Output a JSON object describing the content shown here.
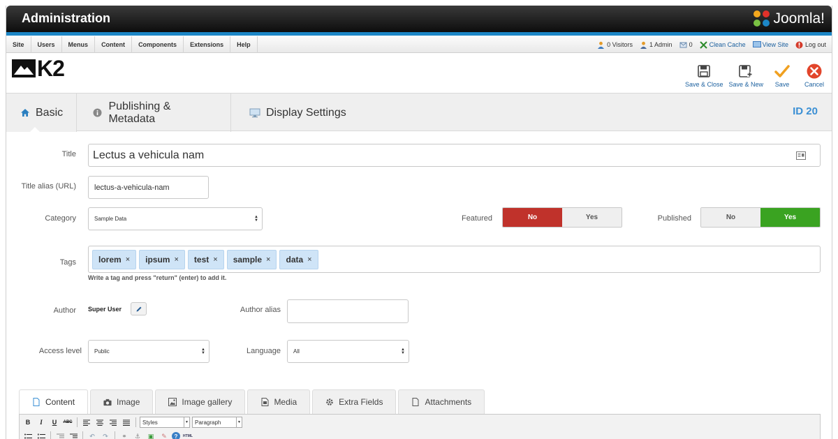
{
  "header": {
    "title": "Administration",
    "brand": "Joomla!"
  },
  "menu": {
    "items": [
      "Site",
      "Users",
      "Menus",
      "Content",
      "Components",
      "Extensions",
      "Help"
    ]
  },
  "status": {
    "visitors": "0 Visitors",
    "admins": "1 Admin",
    "messages": "0",
    "clean_cache": "Clean Cache",
    "view_site": "View Site",
    "logout": "Log out"
  },
  "toolbar": {
    "logo_text": "K2",
    "save_close": "Save & Close",
    "save_new": "Save & New",
    "save": "Save",
    "cancel": "Cancel"
  },
  "tabs": {
    "basic": "Basic",
    "publishing": "Publishing & Metadata",
    "display": "Display Settings",
    "id_label": "ID 20"
  },
  "form": {
    "title_label": "Title",
    "title_value": "Lectus a vehicula nam",
    "alias_label": "Title alias (URL)",
    "alias_value": "lectus-a-vehicula-nam",
    "category_label": "Category",
    "category_value": "Sample Data",
    "featured_label": "Featured",
    "featured_no": "No",
    "featured_yes": "Yes",
    "published_label": "Published",
    "published_no": "No",
    "published_yes": "Yes",
    "tags_label": "Tags",
    "tags": [
      "lorem",
      "ipsum",
      "test",
      "sample",
      "data"
    ],
    "tags_hint": "Write a tag and press \"return\" (enter) to add it.",
    "author_label": "Author",
    "author_value": "Super User",
    "author_alias_label": "Author alias",
    "author_alias_value": "",
    "access_label": "Access level",
    "access_value": "Public",
    "language_label": "Language",
    "language_value": "All"
  },
  "editor_tabs": {
    "content": "Content",
    "image": "Image",
    "gallery": "Image gallery",
    "media": "Media",
    "extra": "Extra Fields",
    "attachments": "Attachments"
  },
  "editor": {
    "styles": "Styles",
    "paragraph": "Paragraph"
  },
  "colors": {
    "accent": "#1c86c6",
    "danger": "#c0322b",
    "success": "#3aa321",
    "id_color": "#3a8fd4"
  }
}
